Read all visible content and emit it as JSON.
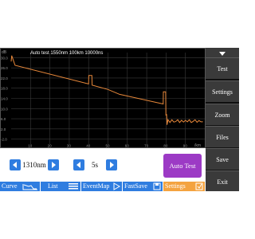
{
  "chart": {
    "title": "Auto test 1550nm 100km 10000ns",
    "y_unit": "dB",
    "x_unit": "/km",
    "y_ticks": [
      "30.0",
      "26.0",
      "22.0",
      "18.0",
      "14.0",
      "10.0",
      "6.0",
      "2.0",
      "-2.0"
    ],
    "x_ticks": [
      "10",
      "20",
      "30",
      "40",
      "50",
      "60",
      "70",
      "80",
      "90"
    ]
  },
  "chart_data": {
    "type": "line",
    "title": "Auto test 1550nm 100km 10000ns",
    "xlabel": "/km",
    "ylabel": "dB",
    "xlim": [
      0,
      100
    ],
    "ylim": [
      -4,
      32
    ],
    "grid": true,
    "series": [
      {
        "color": "#e8883a",
        "x": [
          0,
          0.3,
          2,
          40,
          40.1,
          41.7,
          41.8,
          50,
          56,
          78.5,
          78.6,
          79.8,
          79.9,
          80.3,
          80.5,
          81,
          82,
          83,
          84,
          85,
          86,
          87,
          88,
          89,
          90,
          91,
          92,
          93,
          94,
          95,
          96,
          97,
          98,
          99
        ],
        "y": [
          28.5,
          30.8,
          27.0,
          19.7,
          23.0,
          23.0,
          19.2,
          17.5,
          15.6,
          11.8,
          16.6,
          16.6,
          7.5,
          7.6,
          3.6,
          5.6,
          4.5,
          5.6,
          4.7,
          4.9,
          5.6,
          4.5,
          5.4,
          4.7,
          5.4,
          4.8,
          5.6,
          4.5,
          5.0,
          5.6,
          4.6,
          5.3,
          4.8,
          4.8
        ]
      }
    ]
  },
  "controls": {
    "wavelength": "1310nm",
    "time": "5s",
    "auto_test": "Auto Test"
  },
  "sidebar": {
    "items": [
      {
        "label": "Test"
      },
      {
        "label": "Settings"
      },
      {
        "label": "Zoom"
      },
      {
        "label": "Files"
      },
      {
        "label": "Save"
      },
      {
        "label": "Exit"
      }
    ]
  },
  "bottom_tabs": [
    {
      "label": "Curve"
    },
    {
      "label": "List"
    },
    {
      "label": "EventMap"
    },
    {
      "label": "FastSave"
    },
    {
      "label": "Settings"
    }
  ],
  "colors": {
    "chart_bg": "#000000",
    "trace": "#e8883a",
    "accent_blue": "#2f7de0",
    "auto_test_purple": "#9c3ac5",
    "settings_tab_orange": "#f4a340",
    "sidebar_button": "#3a3a3a"
  },
  "icons": {
    "prev": "triangle-left-icon",
    "next": "triangle-right-icon",
    "curve": "curve-icon",
    "list": "list-icon",
    "eventmap": "eventmap-icon",
    "fastsave": "fastsave-icon",
    "settings": "settings-icon"
  }
}
